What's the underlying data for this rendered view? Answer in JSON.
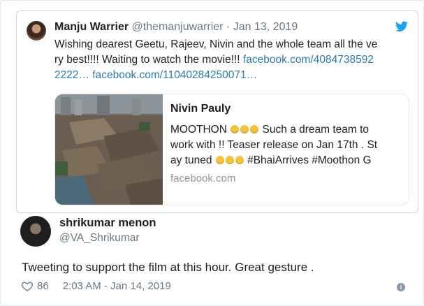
{
  "quoted_tweet": {
    "author_name": "Manju Warrier",
    "author_handle": "@themanjuwarrier",
    "separator": "·",
    "date": "Jan 13, 2019",
    "text_line1": "Wishing dearest Geetu, Rajeev, Nivin and the whole team all the ve",
    "text_line2_prefix": "ry best!!!! Waiting to watch the movie!!! ",
    "link1_a": "facebook.com/4084738592",
    "link1_b": "2222…",
    "link2": "facebook.com/11040284250071…",
    "link_card": {
      "title": "Nivin Pauly",
      "text_1": "MOOTHON",
      "text_2": " Such a dream team to",
      "text_3": "work with !! Teaser release on Jan 17th . St",
      "text_4": "ay tuned",
      "text_5": " #BhaiArrives #Moothon G",
      "domain": "facebook.com"
    }
  },
  "reply": {
    "author_name": "shrikumar menon",
    "author_handle": "@VA_Shrikumar",
    "text": "Tweeting to support the film at this hour. Great gesture .",
    "likes": "86",
    "timestamp": "2:03 AM - Jan 14, 2019"
  },
  "icons": {
    "brand": "twitter-bird-icon",
    "like": "heart-icon",
    "info": "info-icon"
  },
  "colors": {
    "link": "#2b7bb9",
    "twitter_blue": "#1da1f2",
    "muted": "#697882"
  }
}
